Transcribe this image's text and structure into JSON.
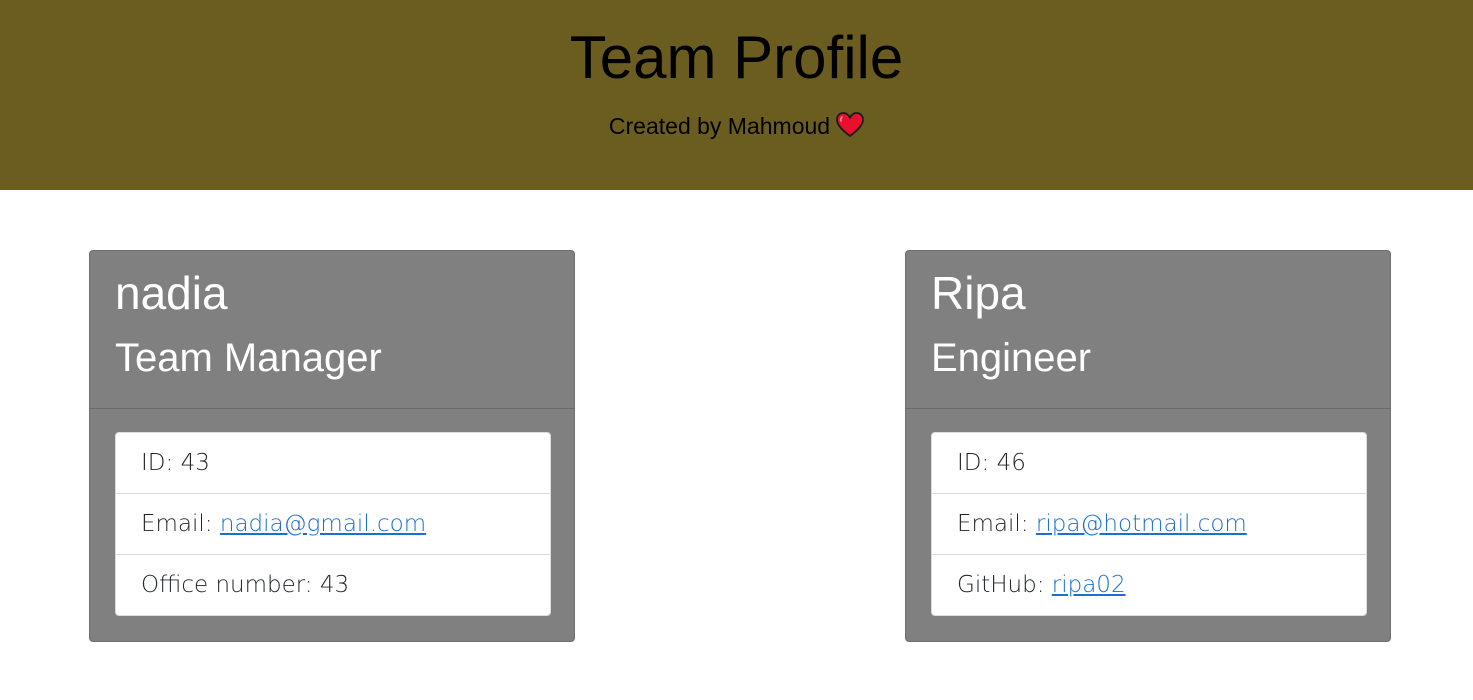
{
  "header": {
    "title": "Team Profile",
    "subtitle": "Created by Mahmoud",
    "background_color": "#6a5d1f",
    "heart_icon": "heart-icon"
  },
  "employees": [
    {
      "name": "nadia",
      "role": "Team Manager",
      "id_label": "ID:",
      "id_value": "43",
      "email_label": "Email:",
      "email": "nadia@gmail.com",
      "extra_label": "Office number:",
      "extra_value": "43"
    },
    {
      "name": "Ripa",
      "role": "Engineer",
      "id_label": "ID:",
      "id_value": "46",
      "email_label": "Email:",
      "email": "ripa@hotmail.com",
      "extra_label": "GitHub:",
      "extra_value": "ripa02"
    }
  ],
  "colors": {
    "card_background": "#808080",
    "link": "#1a6fd1"
  }
}
